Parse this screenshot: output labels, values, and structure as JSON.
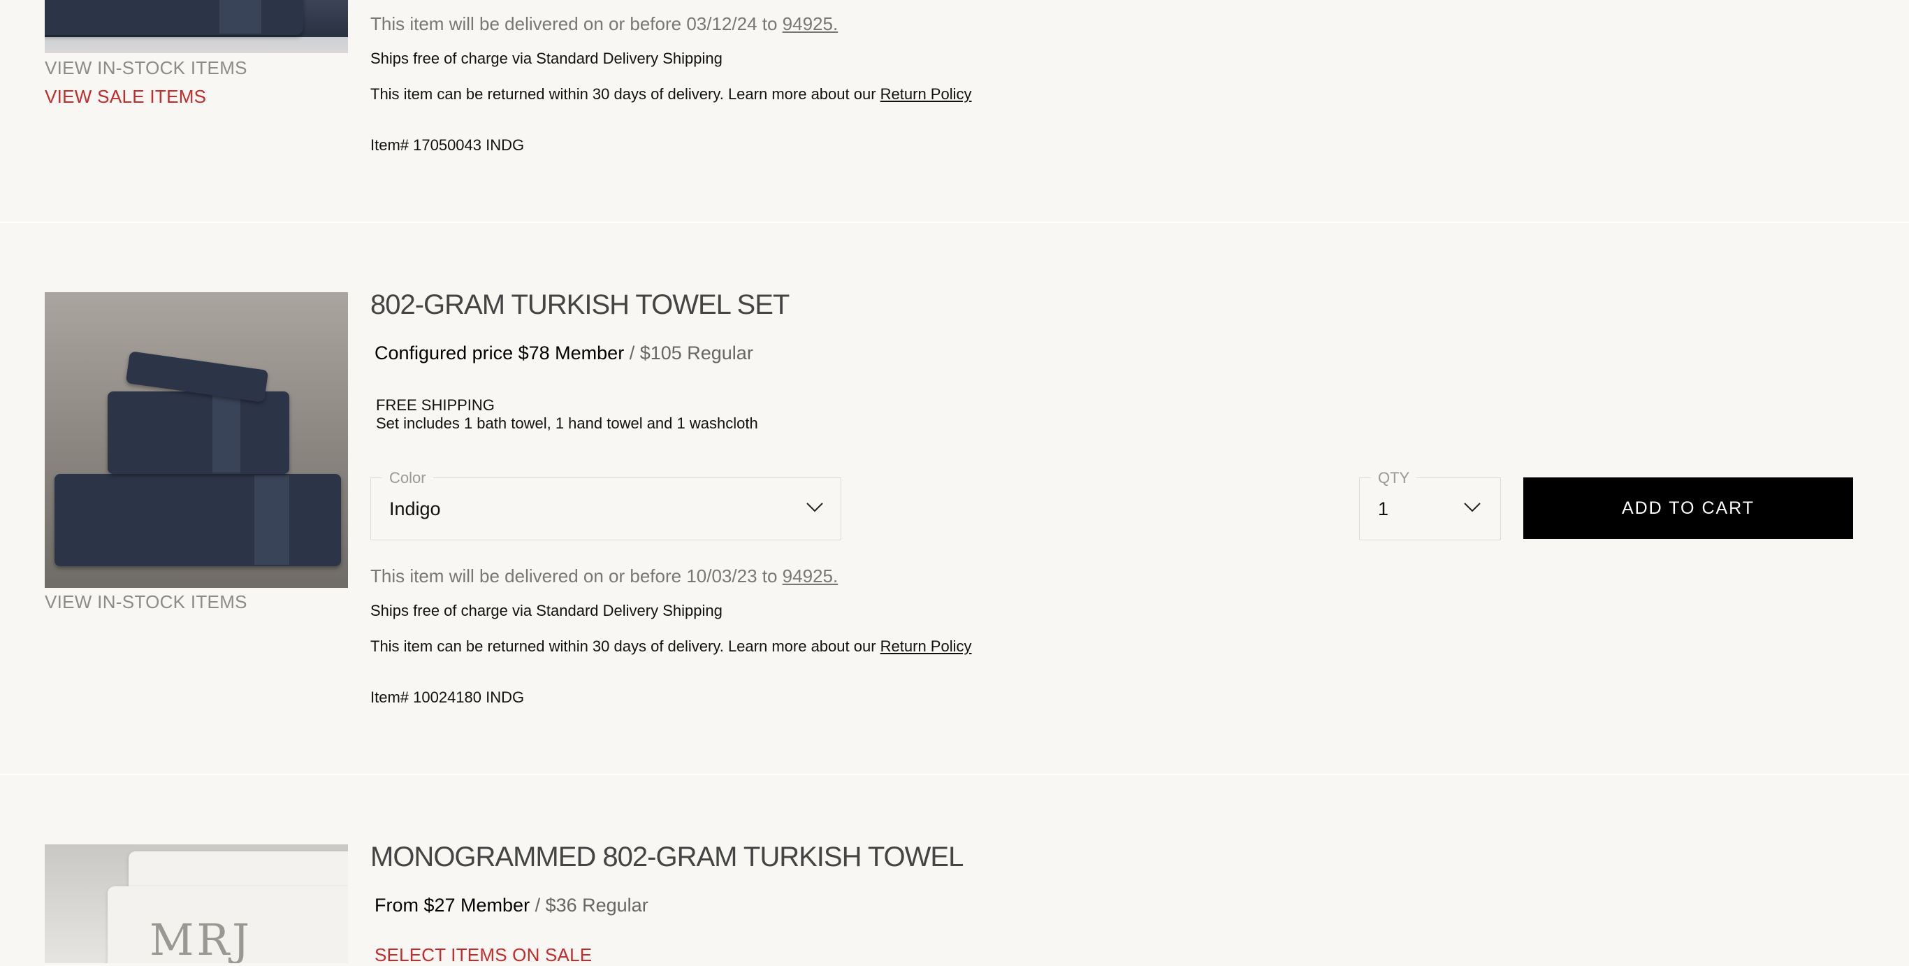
{
  "products": [
    {
      "view_in_stock": "VIEW IN-STOCK ITEMS",
      "view_sale": "VIEW SALE ITEMS",
      "delivery_prefix": "This item will be delivered on or before 03/12/24 to ",
      "delivery_zip": "94925.",
      "shipping_note": "Ships free of charge via Standard Delivery Shipping",
      "return_prefix": "This item can be returned within 30 days of delivery. Learn more about our ",
      "return_link": "Return Policy",
      "item_number": "Item# 17050043 INDG"
    },
    {
      "title": "802-GRAM TURKISH TOWEL SET",
      "price_member": "Configured price $78 Member",
      "price_regular": " / $105 Regular",
      "free_shipping": "FREE SHIPPING",
      "set_includes": "Set includes 1 bath towel, 1 hand towel and 1 washcloth",
      "color_label": "Color",
      "color_value": "Indigo",
      "qty_label": "QTY",
      "qty_value": "1",
      "add_to_cart": "ADD TO CART",
      "view_in_stock": "VIEW IN-STOCK ITEMS",
      "delivery_prefix": "This item will be delivered on or before 10/03/23 to ",
      "delivery_zip": "94925.",
      "shipping_note": "Ships free of charge via Standard Delivery Shipping",
      "return_prefix": "This item can be returned within 30 days of delivery. Learn more about our ",
      "return_link": "Return Policy",
      "item_number": "Item# 10024180 INDG"
    },
    {
      "title": "MONOGRAMMED 802-GRAM TURKISH TOWEL",
      "price_member": "From $27 Member",
      "price_regular": " / $36 Regular",
      "sale_link": "SELECT ITEMS ON SALE",
      "monogram": "MRJ"
    }
  ],
  "colors": {
    "background": "#f8f7f3",
    "sale_red": "#c42b2b",
    "button_black": "#000000"
  }
}
